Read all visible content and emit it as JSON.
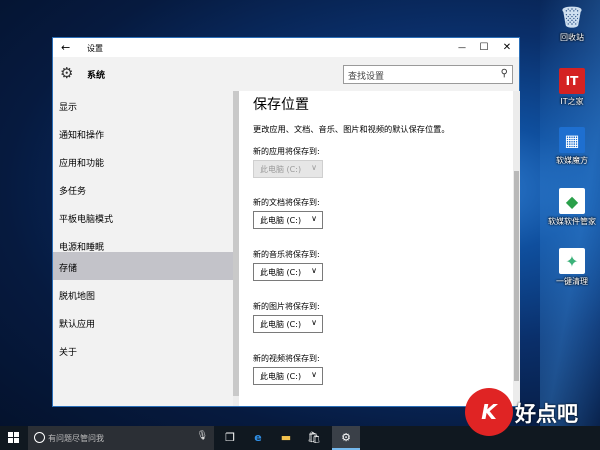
{
  "desktop": {
    "icons": [
      {
        "label": "回收站",
        "glyph": "🗑",
        "color": "#9fb7cf"
      },
      {
        "label": "IT之家",
        "glyph": "IT",
        "color": "#d42222"
      },
      {
        "label": "软媒魔方",
        "glyph": "▦",
        "color": "#1e6fd0"
      },
      {
        "label": "软媒软件管家",
        "glyph": "◆",
        "color": "#2aa04a"
      },
      {
        "label": "一键清理",
        "glyph": "✦",
        "color": "#3cb27a"
      }
    ]
  },
  "window": {
    "title": "设置",
    "back_glyph": "←",
    "controls": {
      "minimize": "—",
      "maximize": "☐",
      "close": "✕"
    },
    "section": "系统",
    "search": {
      "placeholder": "查找设置",
      "icon": "search-icon"
    }
  },
  "sidebar": {
    "items": [
      {
        "label": "显示",
        "active": false
      },
      {
        "label": "通知和操作",
        "active": false
      },
      {
        "label": "应用和功能",
        "active": false
      },
      {
        "label": "多任务",
        "active": false
      },
      {
        "label": "平板电脑模式",
        "active": false
      },
      {
        "label": "电源和睡眠",
        "active": false
      },
      {
        "label": "存储",
        "active": true
      },
      {
        "label": "脱机地图",
        "active": false
      },
      {
        "label": "默认应用",
        "active": false
      },
      {
        "label": "关于",
        "active": false
      }
    ]
  },
  "content": {
    "heading": "保存位置",
    "description": "更改应用、文档、音乐、图片和视频的默认保存位置。",
    "settings": [
      {
        "label": "新的应用将保存到:",
        "value": "此电脑 (C:)",
        "disabled": true
      },
      {
        "label": "新的文档将保存到:",
        "value": "此电脑 (C:)",
        "disabled": false
      },
      {
        "label": "新的音乐将保存到:",
        "value": "此电脑 (C:)",
        "disabled": false
      },
      {
        "label": "新的图片将保存到:",
        "value": "此电脑 (C:)",
        "disabled": false
      },
      {
        "label": "新的视频将保存到:",
        "value": "此电脑 (C:)",
        "disabled": false
      }
    ]
  },
  "taskbar": {
    "search_placeholder": "有问题尽管问我",
    "apps": [
      "task-view",
      "edge",
      "file-explorer",
      "store",
      "settings"
    ]
  },
  "watermark": {
    "text": "好点吧",
    "logo": "K"
  }
}
